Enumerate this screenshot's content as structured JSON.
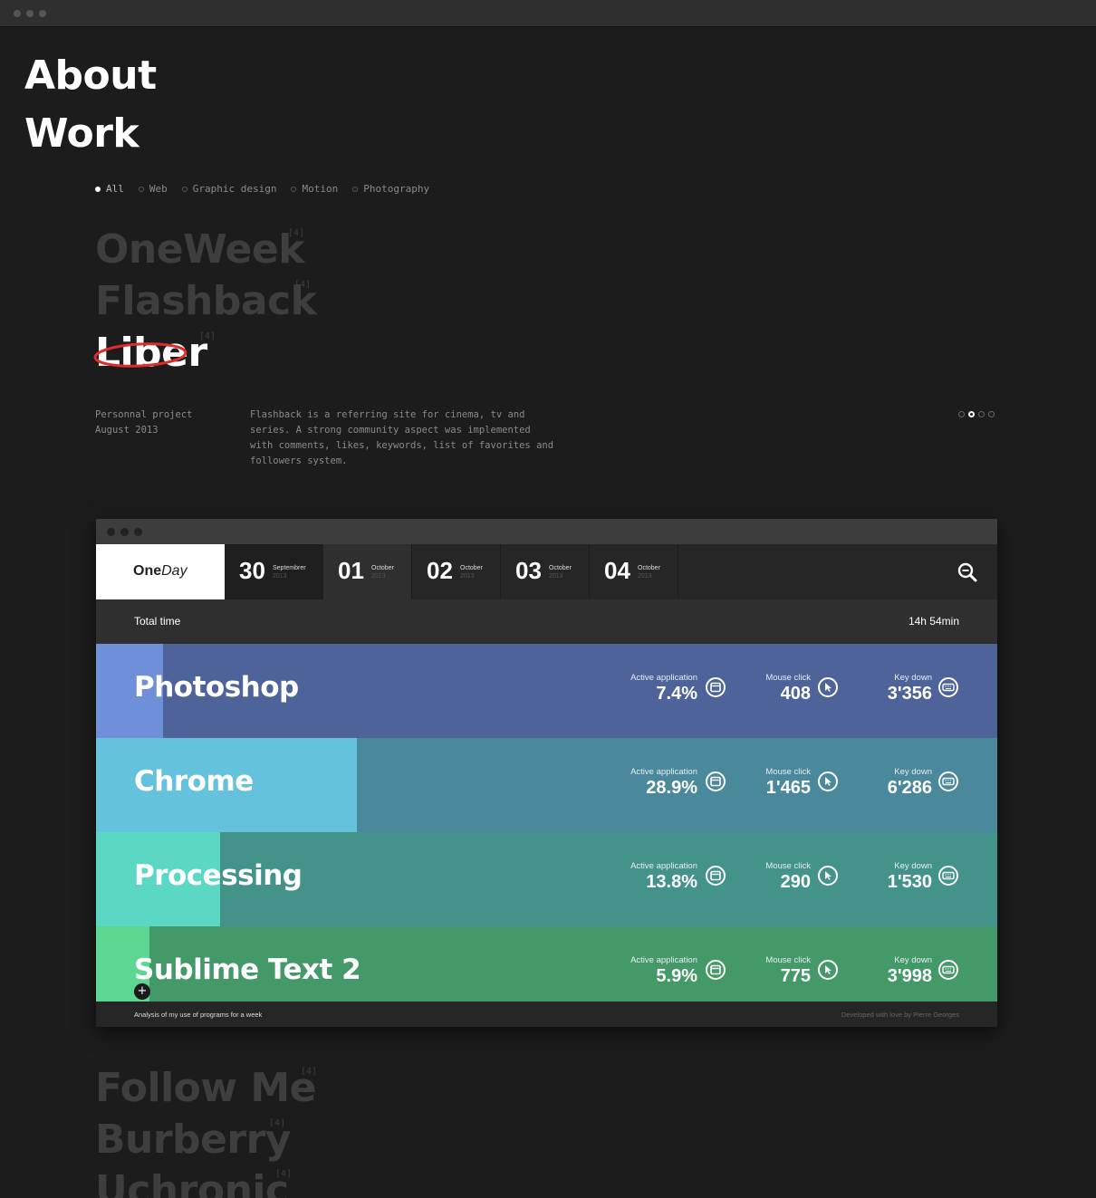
{
  "nav": {
    "about": "About",
    "work": "Work"
  },
  "filters": [
    {
      "label": "All",
      "active": true
    },
    {
      "label": "Web",
      "active": false
    },
    {
      "label": "Graphic design",
      "active": false
    },
    {
      "label": "Motion",
      "active": false
    },
    {
      "label": "Photography",
      "active": false
    }
  ],
  "projects_top": [
    {
      "title": "OneWeek",
      "count": "[4]"
    },
    {
      "title": "Flashback",
      "count": "[4]"
    },
    {
      "title": "Liber",
      "count": "[4]"
    }
  ],
  "project_info": {
    "type": "Personnal project",
    "date": "August 2013",
    "description": "Flashback is a referring site for cinema, tv and series. A strong community aspect was implemented with comments, likes, keywords, list of favorites and followers system.",
    "pager_current": 2,
    "pager_total": 4
  },
  "app": {
    "logo_bold": "One",
    "logo_italic": "Day",
    "days": [
      {
        "num": "30",
        "month": "Septembrer",
        "year": "2013"
      },
      {
        "num": "01",
        "month": "October",
        "year": "2013"
      },
      {
        "num": "02",
        "month": "October",
        "year": "2013"
      },
      {
        "num": "03",
        "month": "October",
        "year": "2013"
      },
      {
        "num": "04",
        "month": "October",
        "year": "2013"
      }
    ],
    "total_label": "Total time",
    "total_value": "14h 54min",
    "stat_labels": {
      "active": "Active application",
      "mouse": "Mouse click",
      "key": "Key down"
    },
    "rows": [
      {
        "name": "Photoshop",
        "active": "7.4%",
        "active_fraction": 0.074,
        "mouse": "408",
        "key": "3'356",
        "bg": "#4d6399",
        "fill": "#6f8fd8"
      },
      {
        "name": "Chrome",
        "active": "28.9%",
        "active_fraction": 0.289,
        "mouse": "1'465",
        "key": "6'286",
        "bg": "#4a889c",
        "fill": "#64c2dc"
      },
      {
        "name": "Processing",
        "active": "13.8%",
        "active_fraction": 0.138,
        "mouse": "290",
        "key": "1'530",
        "bg": "#43938a",
        "fill": "#5ad8c4"
      },
      {
        "name": "Sublime Text 2",
        "active": "5.9%",
        "active_fraction": 0.059,
        "mouse": "775",
        "key": "3'998",
        "bg": "#449968",
        "fill": "#5cd690"
      }
    ],
    "footer_left": "Analysis of my use of programs for a week",
    "footer_right": "Developed with love by Pierre Georges",
    "plus": "+"
  },
  "projects_bottom": [
    {
      "title": "Follow Me",
      "count": "[4]"
    },
    {
      "title": "Burberry",
      "count": "[4]"
    },
    {
      "title": "Uchronic",
      "count": "[4]"
    }
  ],
  "colors": {
    "background": "#1c1c1c",
    "accent_red": "#e02b2b",
    "muted_title": "#3e3e3e"
  }
}
